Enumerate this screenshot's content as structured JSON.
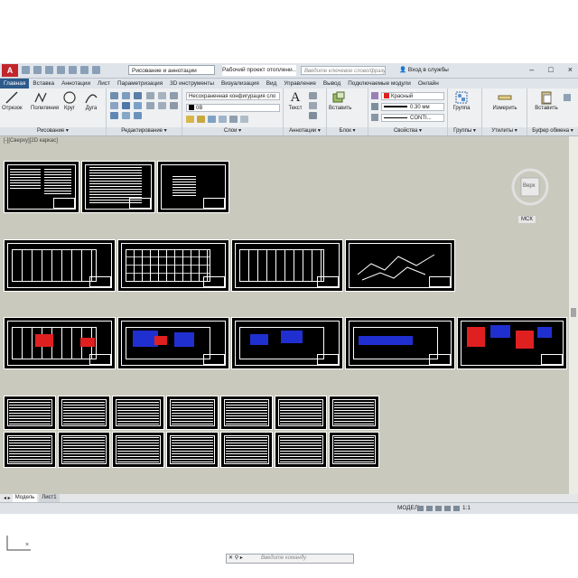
{
  "window": {
    "workspace": "Рисование и аннотации",
    "doc_title": "Рабочий проект отоплени...",
    "search_placeholder": "Введите ключевое слово/фразу",
    "signin": "Вход в службы",
    "controls": [
      "–",
      "□",
      "×"
    ]
  },
  "ribbon_tabs": [
    "Главная",
    "Вставка",
    "Аннотации",
    "Лист",
    "Параметризация",
    "3D инструменты",
    "Визуализация",
    "Вид",
    "Управление",
    "Вывод",
    "Подключаемые модули",
    "Онлайн"
  ],
  "draw_panel": {
    "tools": [
      "Отрезок",
      "Полилиния",
      "Круг",
      "Дуга"
    ],
    "title": "Рисование"
  },
  "edit_panel": {
    "title": "Редактирование"
  },
  "layers_panel": {
    "layer_state": "Несохраненная конфигурация сло",
    "current_layer": "0В",
    "title": "Слои"
  },
  "annot_panel": {
    "text_label": "Текст",
    "title": "Аннотации"
  },
  "block_panel": {
    "insert_label": "Вставить",
    "title": "Блок"
  },
  "props_panel": {
    "color": "Красный",
    "color_hex": "#e02020",
    "lineweight": "0.30 мм",
    "linetype": "CONTI...",
    "title": "Свойства"
  },
  "groups_panel": {
    "group_label": "Группа",
    "title": "Группы"
  },
  "utils_panel": {
    "measure_label": "Измерить",
    "title": "Утилиты"
  },
  "clip_panel": {
    "paste_label": "Вставить",
    "title": "Буфер обмена"
  },
  "viewport_label": "[-][Сверху][2D каркас]",
  "viewcube": {
    "face": "Верх",
    "wcs": "МСК"
  },
  "command_line": {
    "placeholder": "Введите команду"
  },
  "layout_tabs": [
    "Модель",
    "Лист1"
  ],
  "status_bar": {
    "mode": "МОДЕЛЬ",
    "scale": "1:1"
  }
}
